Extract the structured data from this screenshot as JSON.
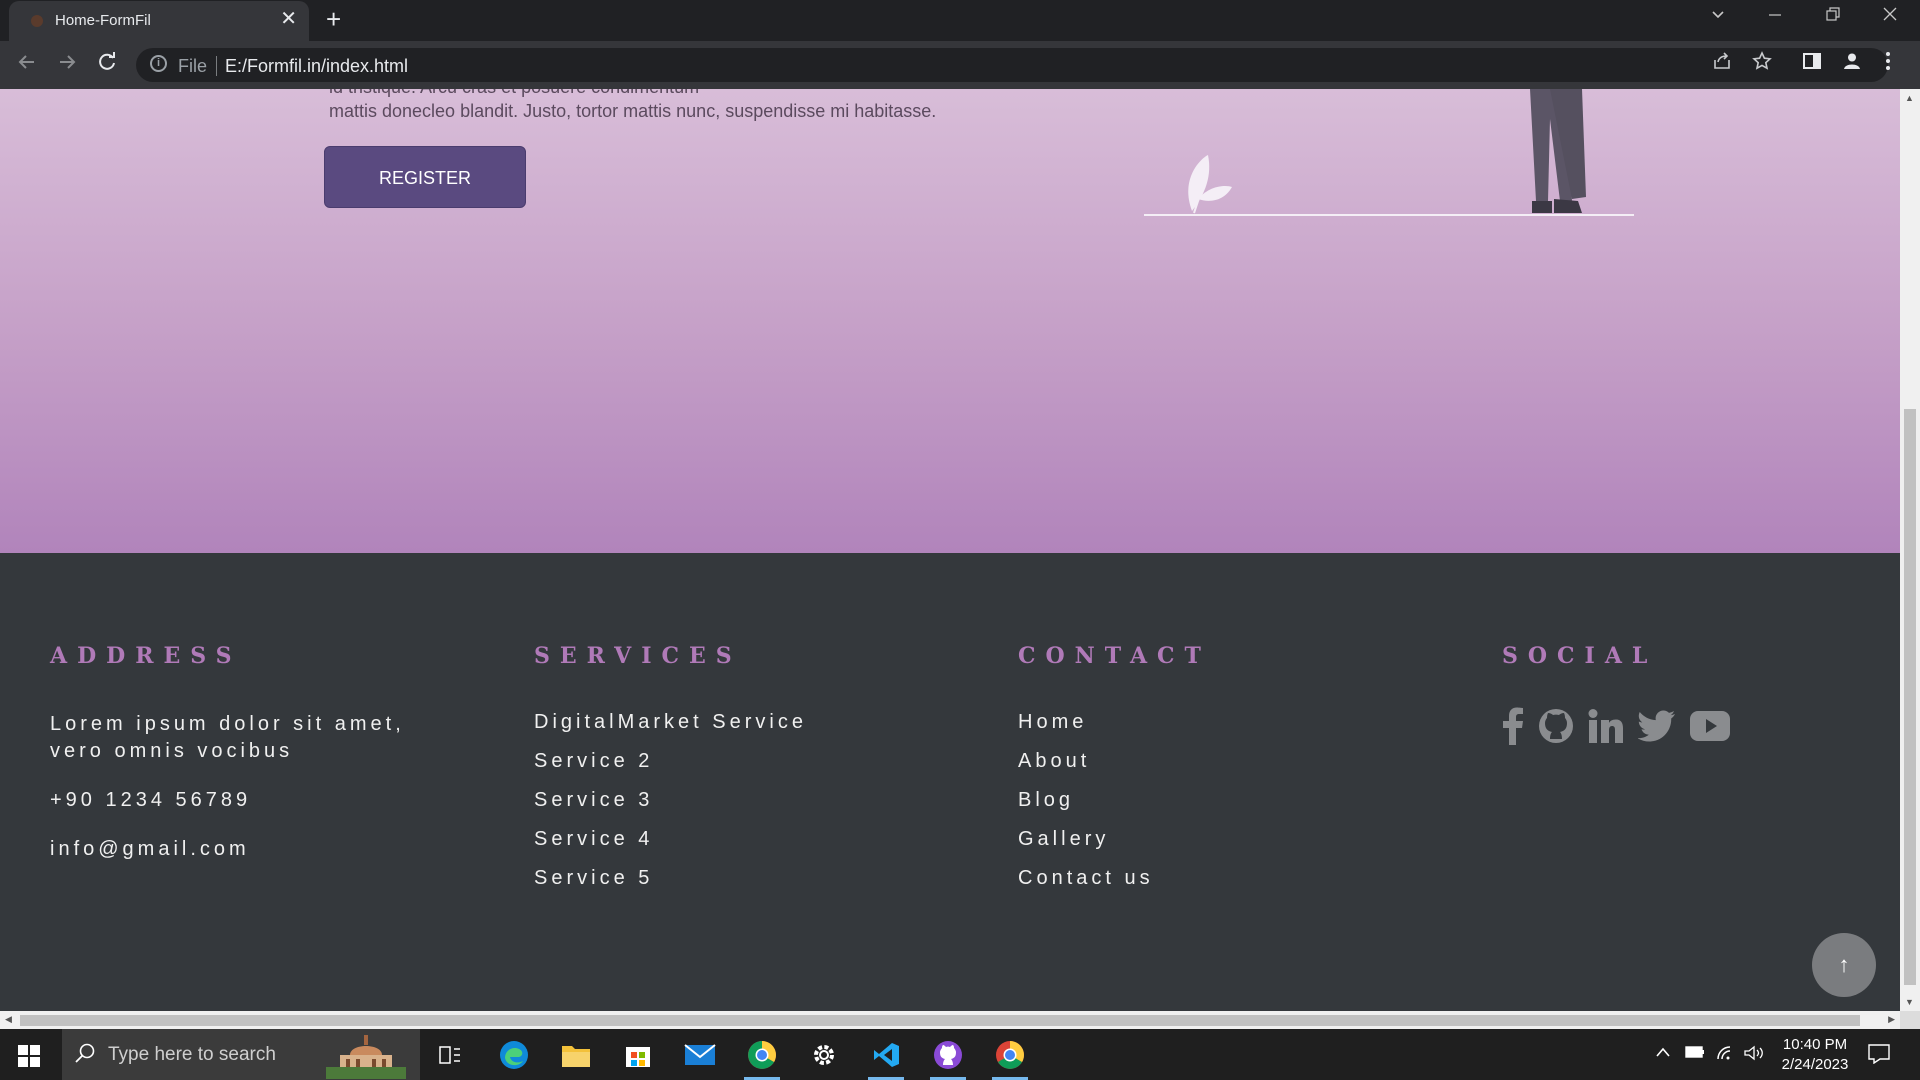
{
  "browser": {
    "tab_title": "Home-FormFil",
    "tab_close": "✕",
    "new_tab": "+",
    "omnibox_file_label": "File",
    "url": "E:/Formfil.in/index.html",
    "icons": [
      "back-icon",
      "forward-icon",
      "reload-icon",
      "info-icon",
      "share-icon",
      "star-icon",
      "side-panel-icon",
      "profile-icon",
      "menu-icon",
      "tab-search-icon",
      "minimize-icon",
      "restore-icon",
      "close-icon"
    ]
  },
  "hero": {
    "text_cut": "id tristique. Arcu cras et posuere condimentum",
    "text": "mattis donecleo blandit. Justo, tortor mattis nunc, suspendisse mi habitasse.",
    "register_label": "REGISTER"
  },
  "footer": {
    "address": {
      "heading": "ADDRESS",
      "line1": "Lorem ipsum dolor sit amet,",
      "line2": "vero omnis vocibus",
      "phone": "+90 1234 56789",
      "email": "info@gmail.com"
    },
    "services": {
      "heading": "SERVICES",
      "items": [
        "DigitalMarket Service",
        "Service 2",
        "Service 3",
        "Service 4",
        "Service 5"
      ]
    },
    "contact": {
      "heading": "CONTACT",
      "items": [
        "Home",
        "About",
        "Blog",
        "Gallery",
        "Contact us"
      ]
    },
    "social": {
      "heading": "SOCIAL",
      "icons": [
        "facebook-icon",
        "github-icon",
        "linkedin-icon",
        "twitter-icon",
        "youtube-icon"
      ]
    },
    "back_to_top": "↑"
  },
  "taskbar": {
    "search_placeholder": "Type here to search",
    "time": "10:40 PM",
    "date": "2/24/2023"
  },
  "colors": {
    "hero_top": "#d8bdd8",
    "hero_bottom": "#b184bb",
    "footer_bg": "#34383c",
    "heading_accent": "#b07ab8",
    "register_bg": "#5a4a80"
  }
}
